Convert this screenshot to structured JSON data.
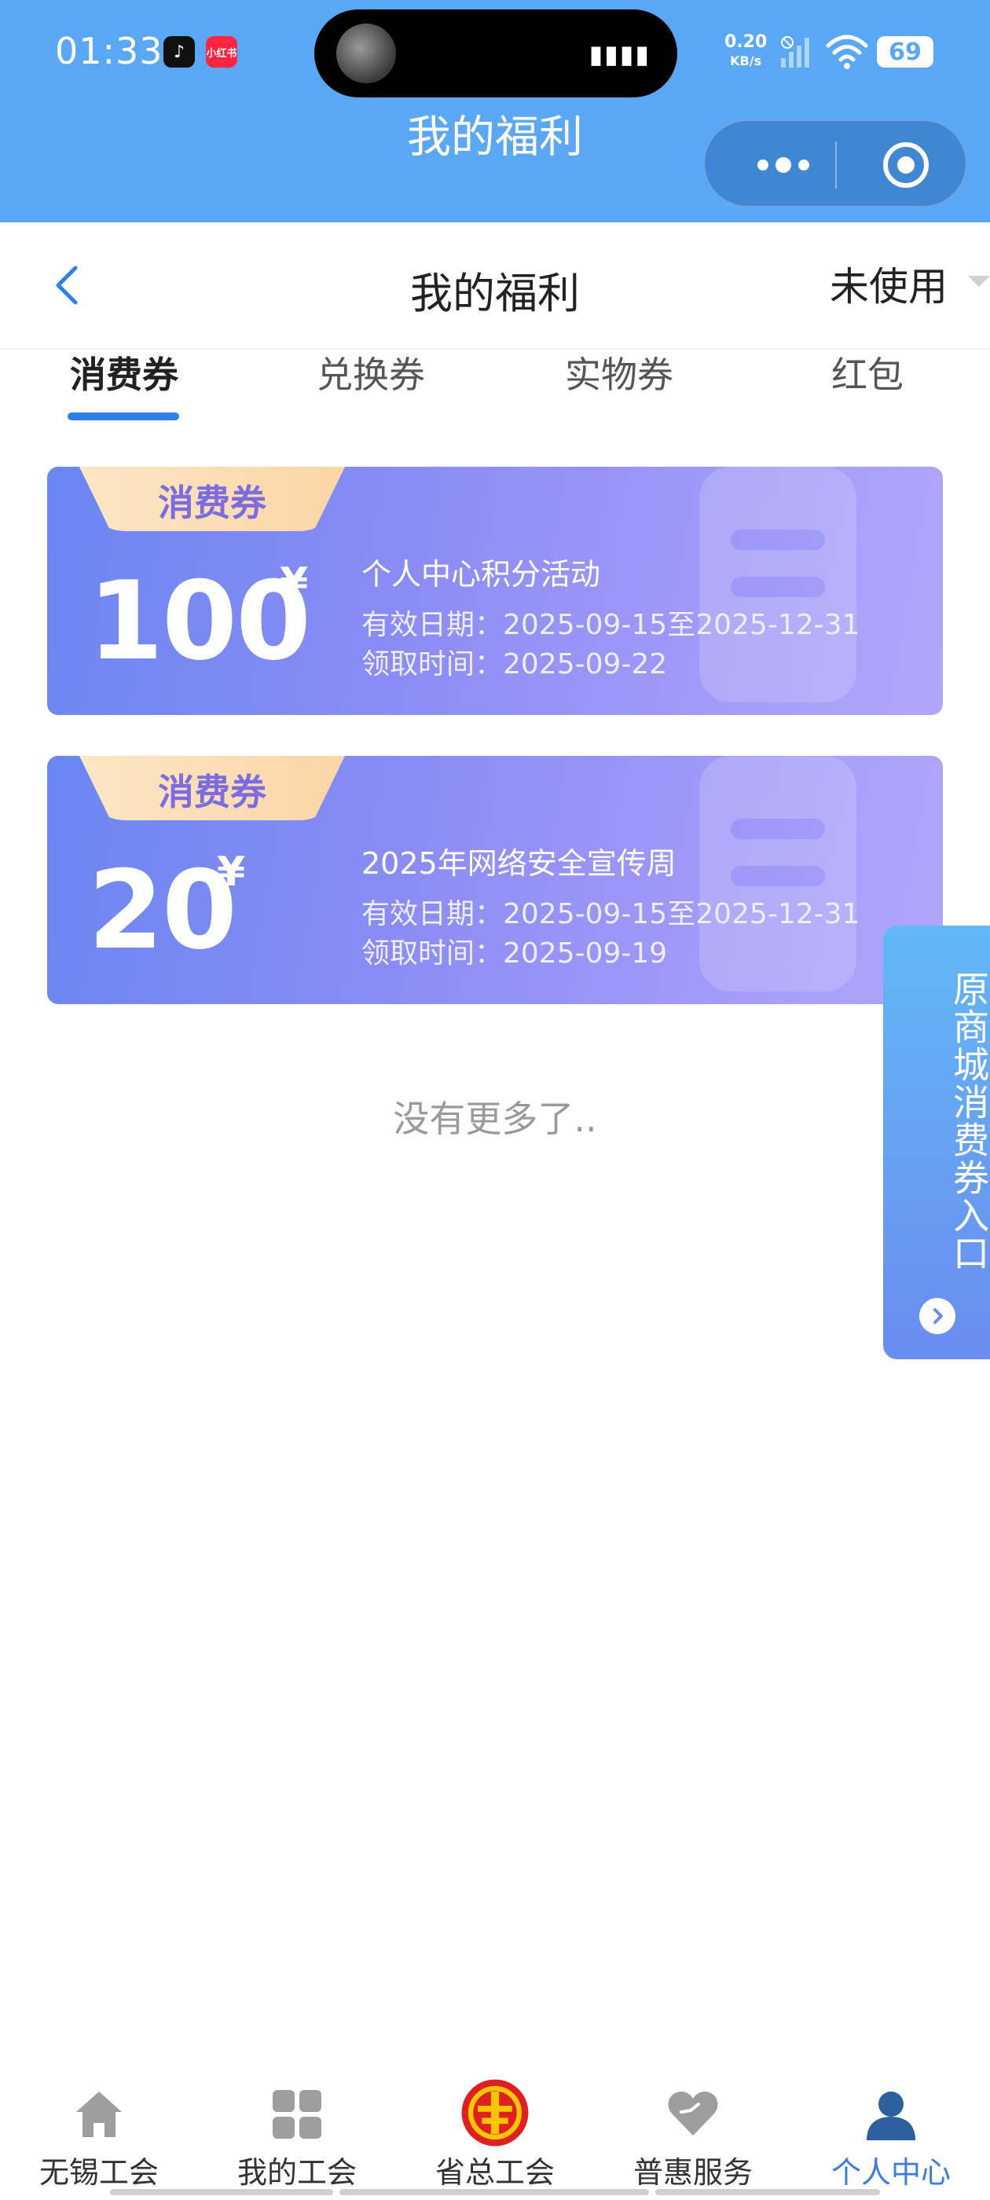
{
  "status_bar": {
    "time": "01:33",
    "app_icons": [
      "music-app-icon",
      "xiaohongshu-icon"
    ],
    "xhs_label": "小红书",
    "net_speed": "0.20",
    "net_unit": "KB/s",
    "battery": "69"
  },
  "miniprogram": {
    "title": "我的福利"
  },
  "header": {
    "title": "我的福利",
    "status_filter": "未使用"
  },
  "tabs": [
    {
      "label": "消费券",
      "active": true
    },
    {
      "label": "兑换券",
      "active": false
    },
    {
      "label": "实物券",
      "active": false
    },
    {
      "label": "红包",
      "active": false
    }
  ],
  "coupons": [
    {
      "badge": "消费券",
      "amount": "100",
      "currency": "¥",
      "activity": "个人中心积分活动",
      "valid": "有效日期：2025-09-15至2025-12-31",
      "received": "领取时间：2025-09-22"
    },
    {
      "badge": "消费券",
      "amount": "20",
      "currency": "¥",
      "activity": "2025年网络安全宣传周",
      "valid": "有效日期：2025-09-15至2025-12-31",
      "received": "领取时间：2025-09-19"
    }
  ],
  "list_end": "没有更多了..",
  "float_entry": {
    "text": "原商城消费券入口"
  },
  "bottom_nav": [
    {
      "label": "无锡工会",
      "icon": "home-icon",
      "active": false
    },
    {
      "label": "我的工会",
      "icon": "grid-icon",
      "active": false
    },
    {
      "label": "省总工会",
      "icon": "union-emblem-icon",
      "active": false
    },
    {
      "label": "普惠服务",
      "icon": "heart-icon",
      "active": false
    },
    {
      "label": "个人中心",
      "icon": "person-icon",
      "active": true
    }
  ],
  "colors": {
    "topbar": "#5aa8f5",
    "active_tab": "#2f80e6",
    "active_nav": "#3a7de0"
  }
}
